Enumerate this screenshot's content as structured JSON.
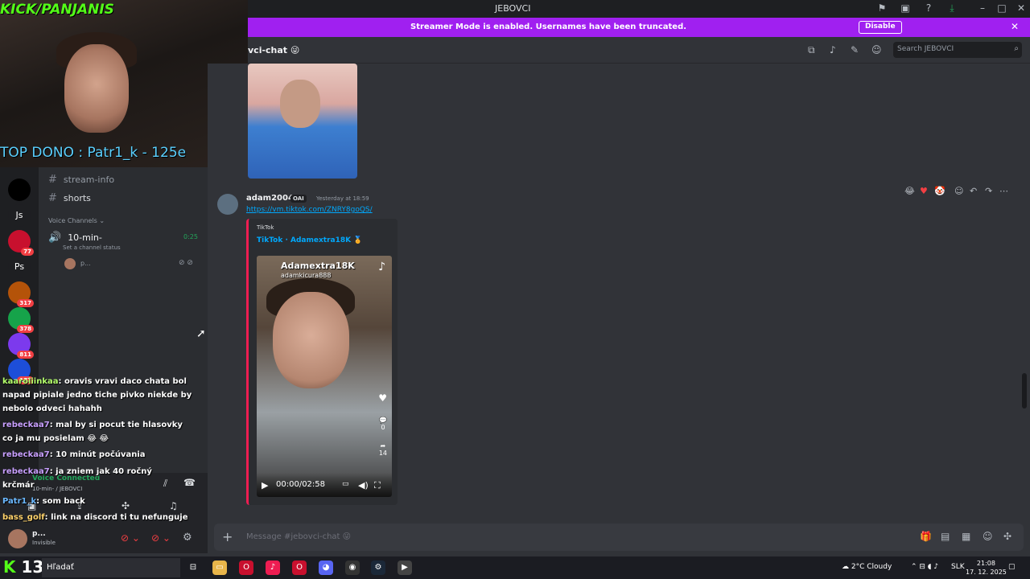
{
  "window": {
    "title": "JEBOVCI"
  },
  "banner": {
    "message": "Streamer Mode is enabled. Usernames have been truncated.",
    "button": "Disable"
  },
  "header": {
    "channel_name": "vci-chat",
    "search_placeholder": "Search JEBOVCI"
  },
  "webcam": {
    "kick_tag": "KICK/PANJANIS",
    "top_dono": "TOP DONO : Patr1_k - 125e"
  },
  "sidebar": {
    "channels": [
      "stream-info",
      "shorts"
    ],
    "voice_section": "Voice Channels",
    "voice_channel": "10-min-",
    "voice_timer": "0:25",
    "channel_status": "Set a channel status",
    "voice_user": "p..."
  },
  "servers": [
    {
      "label": "",
      "color": "#000000",
      "badge": ""
    },
    {
      "label": "Js",
      "color": "#1e1f22",
      "badge": ""
    },
    {
      "label": "",
      "color": "#c8102e",
      "badge": "77"
    },
    {
      "label": "Ps",
      "color": "#1e1f22",
      "badge": ""
    },
    {
      "label": "",
      "color": "#b45309",
      "badge": "317"
    },
    {
      "label": "",
      "color": "#16a34a",
      "badge": "378"
    },
    {
      "label": "",
      "color": "#7c3aed",
      "badge": "811"
    },
    {
      "label": "",
      "color": "#1d4ed8",
      "badge": "177"
    }
  ],
  "message": {
    "author": "adam2004",
    "tag": "OAI",
    "timestamp": "Yesterday at 18:59",
    "link": "https://vm.tiktok.com/ZNRY8goQS/",
    "embed_provider": "TikTok",
    "embed_title": "TikTok · Adamextra18K",
    "video_username": "Adamextra18K",
    "video_handle": "adamkicura888",
    "video_time": "00:00/02:58",
    "comment_count": "0",
    "share_count": "14"
  },
  "chat": [
    {
      "user": "kaaroliinkaa",
      "text": ": oravis vravi daco chata bol"
    },
    {
      "user": "",
      "text": "napad pipiale jedno tiche pivko niekde by"
    },
    {
      "user": "",
      "text": "nebolo odveci hahahh"
    },
    {
      "user": "rebeckaa7",
      "text": ": mal by si pocut tie hlasovky"
    },
    {
      "user": "",
      "text": "co ja mu posielam 😂 😂"
    },
    {
      "user": "rebeckaa7",
      "text": ": 10 minút počúvania"
    },
    {
      "user": "rebeckaa7",
      "text": ": ja zniem jak 40 ročný"
    },
    {
      "user": "",
      "text": "krčmár"
    },
    {
      "user": "Patr1_k",
      "text": ": som back"
    },
    {
      "user": "bass_golf",
      "text": ": link na discord ti tu nefunguje"
    }
  ],
  "voice_panel": {
    "status": "Voice Connected",
    "location": "10-min- / JEBOVCI"
  },
  "user_panel": {
    "name": "p...",
    "status": "Invisible"
  },
  "composer": {
    "placeholder": "Message #jebovci-chat"
  },
  "taskbar": {
    "search": "Hľadať",
    "kick_number": "13",
    "weather": "2°C  Cloudy",
    "lang": "SLK",
    "time": "21:08",
    "date": "17. 12. 2025"
  },
  "colors": {
    "banner": "#a020f0",
    "link": "#00a8fc",
    "kick_green": "#53fc18",
    "voice_green": "#23a55a"
  }
}
